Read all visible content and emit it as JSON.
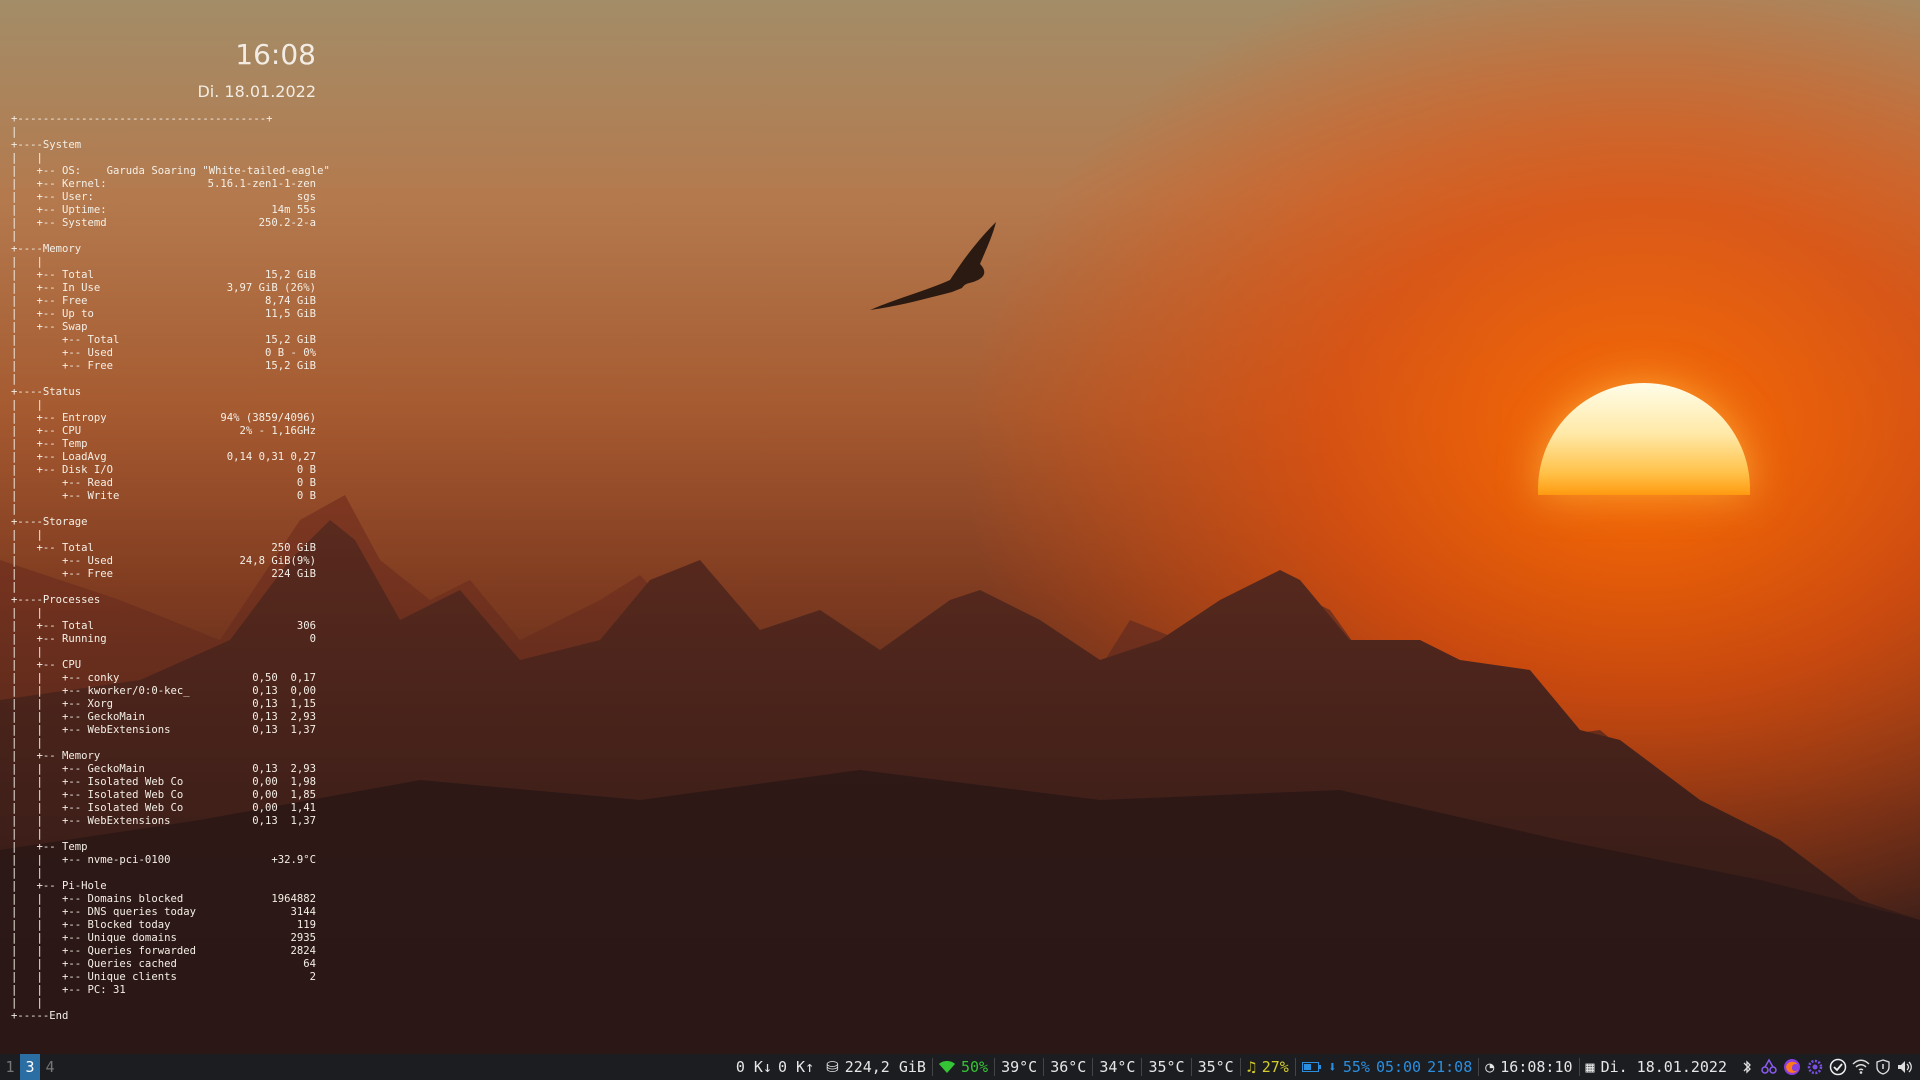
{
  "clock": {
    "time": "16:08",
    "date": "Di. 18.01.2022"
  },
  "conky": {
    "rows": [
      {
        "t": "+---------------------------------------+",
        "v": ""
      },
      {
        "t": "|",
        "v": ""
      },
      {
        "t": "+----System",
        "v": ""
      },
      {
        "t": "|   |",
        "v": ""
      },
      {
        "t": "|   +-- OS:    Garuda Soaring \"White-tailed-eagle\"",
        "v": ""
      },
      {
        "t": "|   +-- Kernel:",
        "v": "5.16.1-zen1-1-zen"
      },
      {
        "t": "|   +-- User:",
        "v": "sgs"
      },
      {
        "t": "|   +-- Uptime:",
        "v": "14m 55s"
      },
      {
        "t": "|   +-- Systemd",
        "v": "250.2-2-a"
      },
      {
        "t": "|",
        "v": ""
      },
      {
        "t": "+----Memory",
        "v": ""
      },
      {
        "t": "|   |",
        "v": ""
      },
      {
        "t": "|   +-- Total",
        "v": "15,2 GiB"
      },
      {
        "t": "|   +-- In Use",
        "v": "3,97 GiB (26%)"
      },
      {
        "t": "|   +-- Free",
        "v": "8,74 GiB"
      },
      {
        "t": "|   +-- Up to",
        "v": "11,5 GiB"
      },
      {
        "t": "|   +-- Swap",
        "v": ""
      },
      {
        "t": "|       +-- Total",
        "v": "15,2 GiB"
      },
      {
        "t": "|       +-- Used",
        "v": "0 B - 0%"
      },
      {
        "t": "|       +-- Free",
        "v": "15,2 GiB"
      },
      {
        "t": "|",
        "v": ""
      },
      {
        "t": "+----Status",
        "v": ""
      },
      {
        "t": "|   |",
        "v": ""
      },
      {
        "t": "|   +-- Entropy",
        "v": "94% (3859/4096)"
      },
      {
        "t": "|   +-- CPU",
        "v": "2% - 1,16GHz"
      },
      {
        "t": "|   +-- Temp",
        "v": ""
      },
      {
        "t": "|   +-- LoadAvg",
        "v": "0,14 0,31 0,27"
      },
      {
        "t": "|   +-- Disk I/O",
        "v": "0 B"
      },
      {
        "t": "|       +-- Read",
        "v": "0 B"
      },
      {
        "t": "|       +-- Write",
        "v": "0 B"
      },
      {
        "t": "|",
        "v": ""
      },
      {
        "t": "+----Storage",
        "v": ""
      },
      {
        "t": "|   |",
        "v": ""
      },
      {
        "t": "|   +-- Total",
        "v": "250 GiB"
      },
      {
        "t": "|       +-- Used",
        "v": "24,8 GiB(9%)"
      },
      {
        "t": "|       +-- Free",
        "v": "224 GiB"
      },
      {
        "t": "|",
        "v": ""
      },
      {
        "t": "+----Processes",
        "v": ""
      },
      {
        "t": "|   |",
        "v": ""
      },
      {
        "t": "|   +-- Total",
        "v": "306"
      },
      {
        "t": "|   +-- Running",
        "v": "0"
      },
      {
        "t": "|   |",
        "v": ""
      },
      {
        "t": "|   +-- CPU",
        "v": ""
      },
      {
        "t": "|   |   +-- conky",
        "v": "0,50  0,17"
      },
      {
        "t": "|   |   +-- kworker/0:0-kec_",
        "v": "0,13  0,00"
      },
      {
        "t": "|   |   +-- Xorg",
        "v": "0,13  1,15"
      },
      {
        "t": "|   |   +-- GeckoMain",
        "v": "0,13  2,93"
      },
      {
        "t": "|   |   +-- WebExtensions",
        "v": "0,13  1,37"
      },
      {
        "t": "|   |",
        "v": ""
      },
      {
        "t": "|   +-- Memory",
        "v": ""
      },
      {
        "t": "|   |   +-- GeckoMain",
        "v": "0,13  2,93"
      },
      {
        "t": "|   |   +-- Isolated Web Co",
        "v": "0,00  1,98"
      },
      {
        "t": "|   |   +-- Isolated Web Co",
        "v": "0,00  1,85"
      },
      {
        "t": "|   |   +-- Isolated Web Co",
        "v": "0,00  1,41"
      },
      {
        "t": "|   |   +-- WebExtensions",
        "v": "0,13  1,37"
      },
      {
        "t": "|   |",
        "v": ""
      },
      {
        "t": "|   +-- Temp",
        "v": ""
      },
      {
        "t": "|   |   +-- nvme-pci-0100",
        "v": "+32.9°C"
      },
      {
        "t": "|   |",
        "v": ""
      },
      {
        "t": "|   +-- Pi-Hole",
        "v": ""
      },
      {
        "t": "|   |   +-- Domains blocked",
        "v": "1964882"
      },
      {
        "t": "|   |   +-- DNS queries today",
        "v": "3144"
      },
      {
        "t": "|   |   +-- Blocked today",
        "v": "119"
      },
      {
        "t": "|   |   +-- Unique domains",
        "v": "2935"
      },
      {
        "t": "|   |   +-- Queries forwarded",
        "v": "2824"
      },
      {
        "t": "|   |   +-- Queries cached",
        "v": "64"
      },
      {
        "t": "|   |   +-- Unique clients",
        "v": "2"
      },
      {
        "t": "|   |   +-- PC: 31",
        "v": ""
      },
      {
        "t": "|   |",
        "v": ""
      },
      {
        "t": "+-----End",
        "v": ""
      }
    ]
  },
  "taskbar": {
    "workspaces": [
      "1",
      "3",
      "4"
    ],
    "active_workspace": "3",
    "net_down": "0 K↓",
    "net_up": "0 K↑",
    "disk": "224,2 GiB",
    "wifi": "50%",
    "temps": [
      "39°C",
      "36°C",
      "34°C",
      "35°C",
      "35°C"
    ],
    "volume": "27%",
    "battery": "55%",
    "battery_time": "05:00",
    "battery_until": "21:08",
    "time": "16:08:10",
    "date": "Di. 18.01.2022",
    "colors": {
      "green": "#35c435",
      "yellow": "#d4cc2a",
      "blue": "#2a8fe0",
      "active_ws": "#2b6ea3"
    },
    "tray_icons": [
      "bluetooth-icon",
      "kdeconnect-icon",
      "firefox-icon",
      "settings-icon",
      "check-icon",
      "wifi-icon",
      "shield-icon",
      "volume-icon"
    ]
  }
}
